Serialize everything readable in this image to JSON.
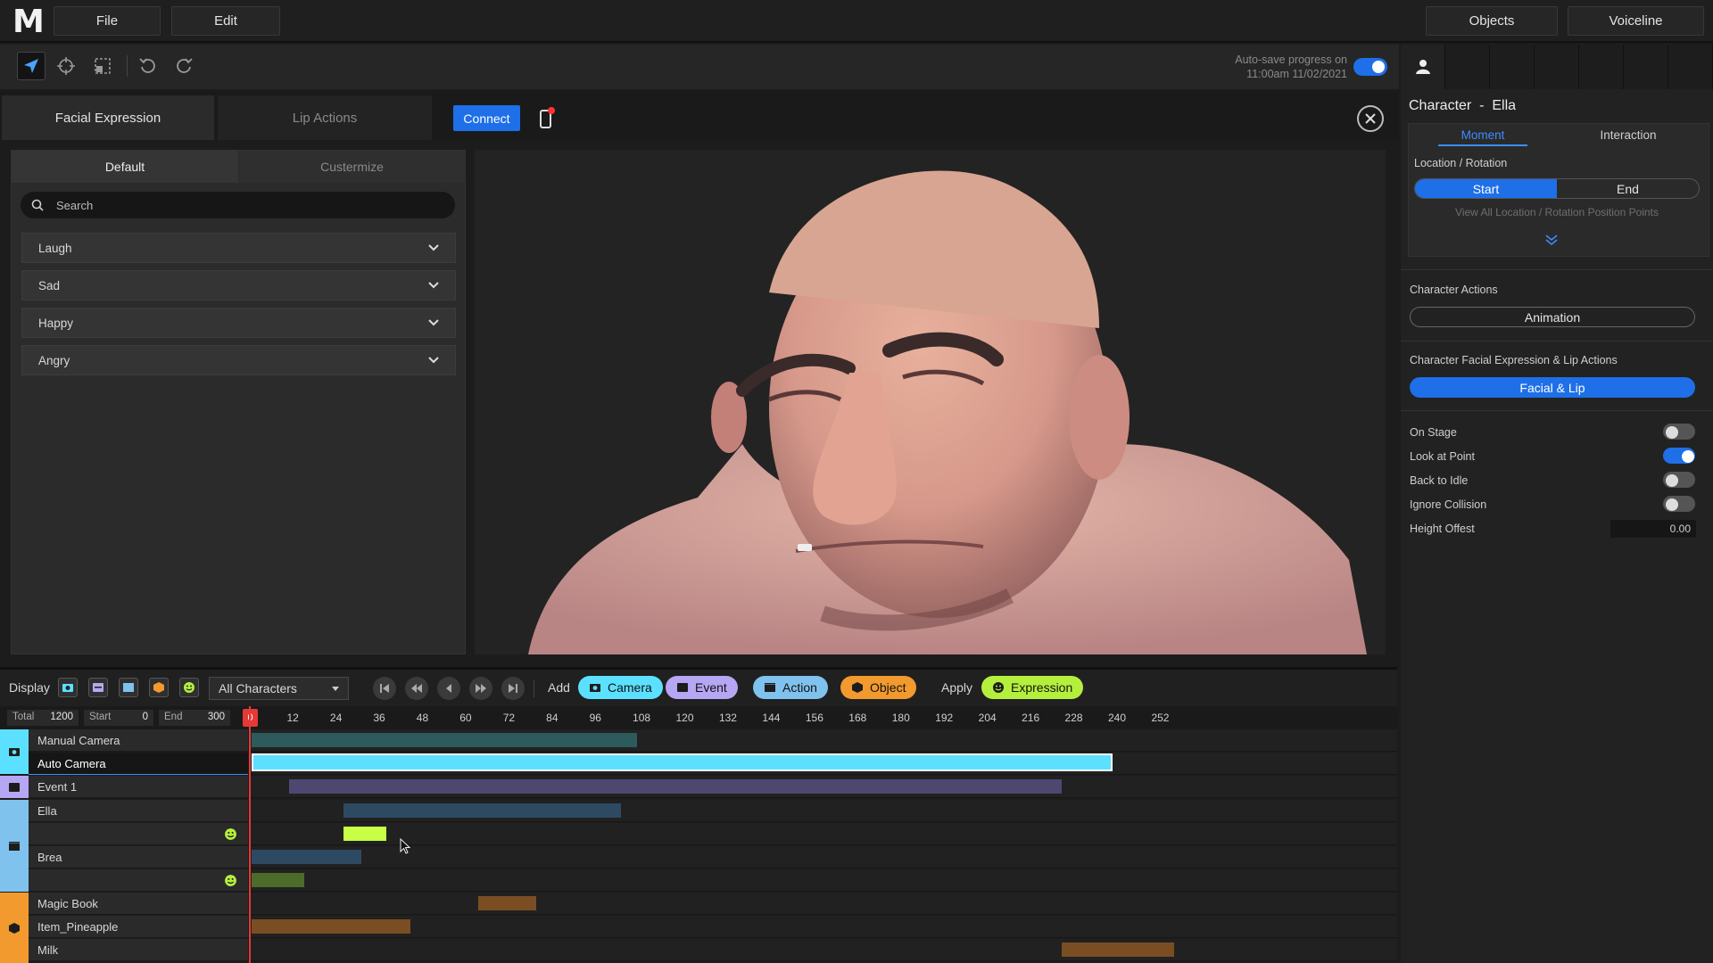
{
  "menu": {
    "logo": "M",
    "file": "File",
    "edit": "Edit",
    "objects": "Objects",
    "voiceline": "Voiceline"
  },
  "toolbar": {
    "autosave_line1": "Auto-save progress on",
    "autosave_line2": "11:00am 11/02/2021",
    "autosave_on": true
  },
  "facial_panel": {
    "tabs": [
      "Facial Expression",
      "Lip Actions"
    ],
    "active_tab": "Facial Expression",
    "connect_label": "Connect",
    "subtabs": [
      "Default",
      "Custermize"
    ],
    "search_placeholder": "Search",
    "expressions": [
      "Laugh",
      "Sad",
      "Happy",
      "Angry"
    ]
  },
  "inspector": {
    "title": "Character  -  Ella",
    "tabs": [
      "Moment",
      "Interaction"
    ],
    "location_label": "Location / Rotation",
    "start_label": "Start",
    "end_label": "End",
    "view_all": "View All Location / Rotation Position Points",
    "actions_label": "Character Actions",
    "animation_label": "Animation",
    "facial_label": "Character Facial Expression & Lip Actions",
    "facial_btn": "Facial & Lip",
    "toggles": [
      {
        "label": "On Stage",
        "on": false
      },
      {
        "label": "Look at Point",
        "on": true
      },
      {
        "label": "Back to Idle",
        "on": false
      },
      {
        "label": "Ignore Collision",
        "on": false
      }
    ],
    "height_offset_label": "Height Offest",
    "height_offset_value": "0.00"
  },
  "timeline": {
    "display_label": "Display",
    "filter": "All Characters",
    "add_label": "Add",
    "apply_label": "Apply",
    "chips": [
      "Camera",
      "Event",
      "Action",
      "Object"
    ],
    "apply_chip": "Expression",
    "total_label": "Total",
    "total": "1200",
    "start_label": "Start",
    "start": "0",
    "end_label": "End",
    "end": "300",
    "playhead": "0",
    "ticks": [
      "12",
      "24",
      "36",
      "48",
      "60",
      "72",
      "84",
      "96",
      "108",
      "120",
      "132",
      "144",
      "156",
      "168",
      "180",
      "192",
      "204",
      "216",
      "228",
      "240",
      "252"
    ],
    "tracks": [
      {
        "name": "Manual Camera",
        "start": 0,
        "end": 107,
        "color": "#2d5a5a"
      },
      {
        "name": "Auto Camera",
        "start": 0,
        "end": 239,
        "color": "#5ce0ff"
      },
      {
        "name": "Event 1",
        "start": 10.5,
        "end": 225,
        "color": "#4e4770"
      },
      {
        "name": "Ella",
        "start": 25.5,
        "end": 102.5,
        "color": "#2e4a63"
      },
      {
        "name": "",
        "start": 25.5,
        "end": 37.5,
        "color": "#c8ff44"
      },
      {
        "name": "Brea",
        "start": 0,
        "end": 30.5,
        "color": "#2e4a63"
      },
      {
        "name": "",
        "start": 0,
        "end": 14.5,
        "color": "#4d6b2a"
      },
      {
        "name": "Magic Book",
        "start": 63,
        "end": 79,
        "color": "#7a4e22"
      },
      {
        "name": "Item_Pineapple",
        "start": 0,
        "end": 44,
        "color": "#7a4e22"
      },
      {
        "name": "Milk",
        "start": 225,
        "end": 256,
        "color": "#7a4e22"
      }
    ]
  },
  "colors": {
    "accent": "#1e6fe8",
    "camera": "#5ce0ff",
    "event": "#b7a6f3",
    "action": "#7fc2ee",
    "object": "#f29a2e",
    "expression": "#b5ef3d"
  }
}
